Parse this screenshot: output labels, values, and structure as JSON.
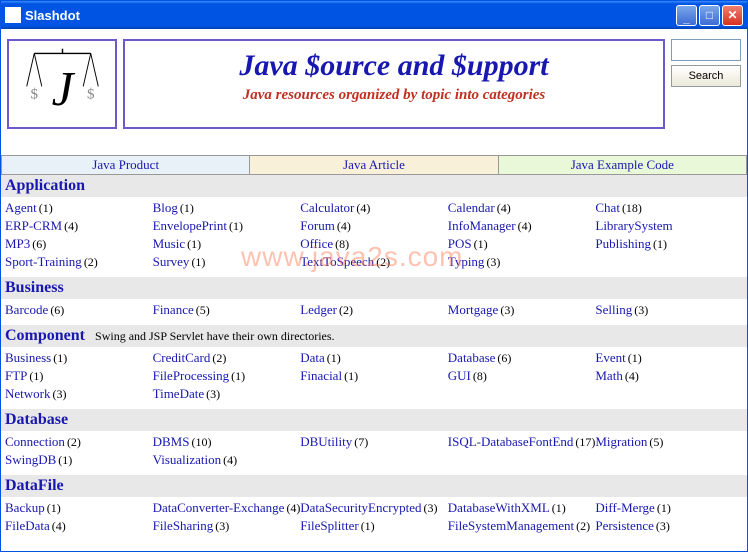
{
  "window": {
    "title": "Slashdot"
  },
  "banner": {
    "title": "Java $ource and $upport",
    "subtitle": "Java resources organized by topic into categories"
  },
  "search": {
    "button": "Search"
  },
  "tabs": [
    "Java Product",
    "Java Article",
    "Java Example Code"
  ],
  "watermark": "www.java2s.com",
  "sections": [
    {
      "title": "Application",
      "rows": [
        [
          {
            "n": "Agent",
            "c": 1
          },
          {
            "n": "Blog",
            "c": 1
          },
          {
            "n": "Calculator",
            "c": 4
          },
          {
            "n": "Calendar",
            "c": 4
          },
          {
            "n": "Chat",
            "c": 18
          }
        ],
        [
          {
            "n": "ERP-CRM",
            "c": 4
          },
          {
            "n": "EnvelopePrint",
            "c": 1
          },
          {
            "n": "Forum",
            "c": 4
          },
          {
            "n": "InfoManager",
            "c": 4
          },
          {
            "n": "LibrarySystem",
            "c": null
          }
        ],
        [
          {
            "n": "MP3",
            "c": 6
          },
          {
            "n": "Music",
            "c": 1
          },
          {
            "n": "Office",
            "c": 8
          },
          {
            "n": "POS",
            "c": 1
          },
          {
            "n": "Publishing",
            "c": 1
          }
        ],
        [
          {
            "n": "Sport-Training",
            "c": 2
          },
          {
            "n": "Survey",
            "c": 1
          },
          {
            "n": "TextToSpeech",
            "c": 2
          },
          {
            "n": "Typing",
            "c": 3
          },
          null
        ]
      ]
    },
    {
      "title": "Business",
      "rows": [
        [
          {
            "n": "Barcode",
            "c": 6
          },
          {
            "n": "Finance",
            "c": 5
          },
          {
            "n": "Ledger",
            "c": 2
          },
          {
            "n": "Mortgage",
            "c": 3
          },
          {
            "n": "Selling",
            "c": 3
          }
        ]
      ]
    },
    {
      "title": "Component",
      "note": "Swing and JSP Servlet have their own directories.",
      "rows": [
        [
          {
            "n": "Business",
            "c": 1
          },
          {
            "n": "CreditCard",
            "c": 2
          },
          {
            "n": "Data",
            "c": 1
          },
          {
            "n": "Database",
            "c": 6
          },
          {
            "n": "Event",
            "c": 1
          }
        ],
        [
          {
            "n": "FTP",
            "c": 1
          },
          {
            "n": "FileProcessing",
            "c": 1
          },
          {
            "n": "Finacial",
            "c": 1
          },
          {
            "n": "GUI",
            "c": 8
          },
          {
            "n": "Math",
            "c": 4
          }
        ],
        [
          {
            "n": "Network",
            "c": 3
          },
          {
            "n": "TimeDate",
            "c": 3
          },
          null,
          null,
          null
        ]
      ]
    },
    {
      "title": "Database",
      "rows": [
        [
          {
            "n": "Connection",
            "c": 2
          },
          {
            "n": "DBMS",
            "c": 10
          },
          {
            "n": "DBUtility",
            "c": 7
          },
          {
            "n": "ISQL-DatabaseFontEnd",
            "c": 17
          },
          {
            "n": "Migration",
            "c": 5
          }
        ],
        [
          {
            "n": "SwingDB",
            "c": 1
          },
          {
            "n": "Visualization",
            "c": 4
          },
          null,
          null,
          null
        ]
      ]
    },
    {
      "title": "DataFile",
      "rows": [
        [
          {
            "n": "Backup",
            "c": 1
          },
          {
            "n": "DataConverter-Exchange",
            "c": 4
          },
          {
            "n": "DataSecurityEncrypted",
            "c": 3
          },
          {
            "n": "DatabaseWithXML",
            "c": 1
          },
          {
            "n": "Diff-Merge",
            "c": 1
          }
        ],
        [
          {
            "n": "FileData",
            "c": 4
          },
          {
            "n": "FileSharing",
            "c": 3
          },
          {
            "n": "FileSplitter",
            "c": 1
          },
          {
            "n": "FileSystemManagement",
            "c": 2
          },
          {
            "n": "Persistence",
            "c": 3
          }
        ]
      ]
    }
  ]
}
